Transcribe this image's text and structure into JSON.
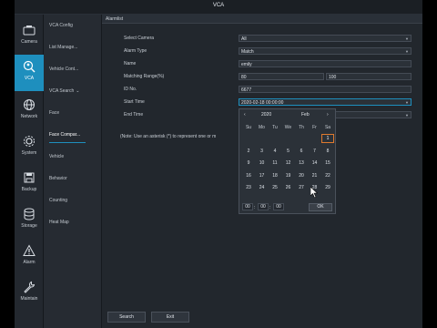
{
  "window": {
    "title": "VCA"
  },
  "rail": {
    "items": [
      {
        "label": "Camera",
        "icon": "camera-icon"
      },
      {
        "label": "VCA",
        "icon": "vca-icon",
        "active": true
      },
      {
        "label": "Network",
        "icon": "globe-icon"
      },
      {
        "label": "System",
        "icon": "gear-icon"
      },
      {
        "label": "Backup",
        "icon": "floppy-icon"
      },
      {
        "label": "Storage",
        "icon": "database-icon"
      },
      {
        "label": "Alarm",
        "icon": "warning-icon"
      },
      {
        "label": "Maintain",
        "icon": "wrench-icon"
      }
    ]
  },
  "subnav": {
    "items": [
      {
        "label": "VCA Config"
      },
      {
        "label": "List Manage..."
      },
      {
        "label": "Vehicle Cont..."
      },
      {
        "label": "VCA Search",
        "arrow": "⌄",
        "expanded": true
      },
      {
        "label": "Face"
      },
      {
        "label": "Face Compar...",
        "active": true
      },
      {
        "label": "Vehicle"
      },
      {
        "label": "Behavior"
      },
      {
        "label": "Counting"
      },
      {
        "label": "Heat Map"
      }
    ]
  },
  "tab": {
    "label": "Alarmlist"
  },
  "form": {
    "select_camera_label": "Select Camera",
    "select_camera_value": "All",
    "alarm_type_label": "Alarm Type",
    "alarm_type_value": "Match",
    "name_label": "Name",
    "name_value": "emily",
    "matching_range_label": "Matching Range(%)",
    "matching_range_min": "80",
    "matching_range_max": "100",
    "id_no_label": "ID No.",
    "id_no_value": "6677",
    "start_time_label": "Start Time",
    "start_time_value": "2020-02-18 00:00:00",
    "end_time_label": "End Time",
    "note": "(Note: Use an asterisk (*) to represent one or m"
  },
  "calendar": {
    "prev": "‹",
    "year": "2020",
    "month": "Feb",
    "next": "›",
    "weekdays": [
      "Su",
      "Mo",
      "Tu",
      "We",
      "Th",
      "Fr",
      "Sa"
    ],
    "selected_day": "1",
    "weeks": [
      [
        "",
        "",
        "",
        "",
        "",
        "",
        "1"
      ],
      [
        "2",
        "3",
        "4",
        "5",
        "6",
        "7",
        "8"
      ],
      [
        "9",
        "10",
        "11",
        "12",
        "13",
        "14",
        "15"
      ],
      [
        "16",
        "17",
        "18",
        "19",
        "20",
        "21",
        "22"
      ],
      [
        "23",
        "24",
        "25",
        "26",
        "27",
        "28",
        "29"
      ]
    ],
    "hour": "00",
    "minute": "00",
    "second": "00",
    "ok_label": "OK"
  },
  "footer": {
    "search_label": "Search",
    "exit_label": "Exit"
  },
  "colors": {
    "accent": "#1e8fbe",
    "selected_day_border": "#e07a2e",
    "background": "#22272d"
  }
}
